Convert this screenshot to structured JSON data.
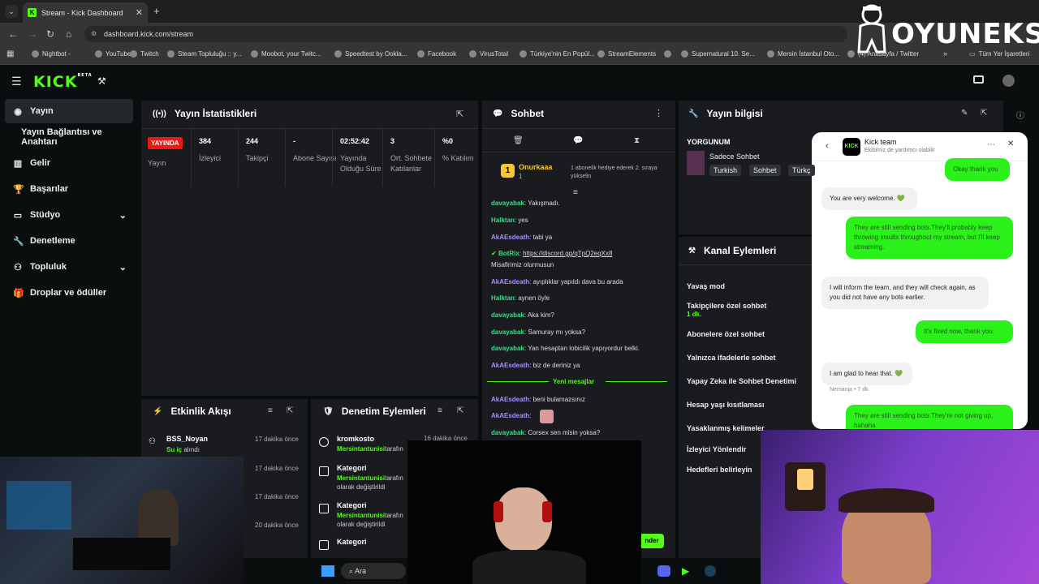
{
  "browser": {
    "tab_title": "Stream - Kick Dashboard",
    "url": "dashboard.kick.com/stream",
    "bookmarks": [
      "Nightbot -",
      "YouTube",
      "Twitch",
      "Steam Topluluğu :: y...",
      "Moobot, your Twitc...",
      "Speedtest by Ookla...",
      "Facebook",
      "VirusTotal",
      "Türkiye'nin En Popül...",
      "StreamElements",
      "",
      "Supernatural 10. Se...",
      "Mersin İstanbul Oto...",
      "(4) Anasayfa / Twitter"
    ],
    "bookmarks_all": "Tüm Yer İşaretleri"
  },
  "overlay_logo": "OYUNEKS",
  "app": {
    "logo": "KICK",
    "logo_badge": "BETA",
    "sidebar": [
      {
        "label": "Yayın",
        "icon": "broadcast-icon"
      },
      {
        "label": "Yayın Bağlantısı ve Anahtarı",
        "icon": ""
      },
      {
        "label": "Gelir",
        "icon": "chart-icon"
      },
      {
        "label": "Başarılar",
        "icon": "trophy-icon"
      },
      {
        "label": "Stüdyo",
        "icon": "monitor-icon"
      },
      {
        "label": "Denetleme",
        "icon": "wrench-icon"
      },
      {
        "label": "Topluluk",
        "icon": "users-icon"
      },
      {
        "label": "Droplar ve ödüller",
        "icon": "gift-icon"
      }
    ]
  },
  "stats": {
    "title": "Yayın İstatistikleri",
    "live_badge": "YAYINDA",
    "live_label": "Yayın",
    "cols": [
      {
        "value": "384",
        "label": "İzleyici"
      },
      {
        "value": "244",
        "label": "Takipçi"
      },
      {
        "value": "-",
        "label": "Abone Sayısı"
      },
      {
        "value": "02:52:42",
        "label": "Yayında Olduğu Süre"
      },
      {
        "value": "3",
        "label": "Ort. Sohbete Katılanlar"
      },
      {
        "value": "%0",
        "label": "% Katılım"
      }
    ]
  },
  "chat": {
    "title": "Sohbet",
    "pinned_user": "Onurkaaa",
    "pinned_count": "1",
    "pinned_text": "1 abonelik hediye ederek 2. sıraya yükselin",
    "messages": [
      {
        "user": "davayabak",
        "text": "Yakışmadı.",
        "color": "g"
      },
      {
        "user": "Halktan",
        "text": "yes",
        "color": "g"
      },
      {
        "user": "AkAEsdeath",
        "text": "tabi ya",
        "color": "p"
      },
      {
        "user": "BotRix",
        "text": "https://discord.gg/qTpQ2eqXx8",
        "color": "g"
      },
      {
        "user": "",
        "text": "Misafirimiz olurmusun",
        "color": ""
      },
      {
        "user": "AkAEsdeath",
        "text": "ayıplıklar yapıldı dava bu arada",
        "color": "p"
      },
      {
        "user": "Halktan",
        "text": "aynen öyle",
        "color": "g"
      },
      {
        "user": "davayabak",
        "text": "Aka kim?",
        "color": "g"
      },
      {
        "user": "davayabak",
        "text": "Samuray mı yoksa?",
        "color": "g"
      },
      {
        "user": "davayabak",
        "text": "Yan hesaptan lobicilik yapıyordur belki.",
        "color": "g"
      },
      {
        "user": "AkAEsdeath",
        "text": "biz de deriniz ya",
        "color": "p"
      }
    ],
    "new_messages": "Yeni mesajlar",
    "after": [
      {
        "user": "AkAEsdeath",
        "text": "beni bulamazsınız",
        "color": "p"
      },
      {
        "user": "AkAEsdeath",
        "text": "",
        "color": "p"
      },
      {
        "user": "davayabak",
        "text": "Corsex sen misin yoksa?",
        "color": "g"
      }
    ],
    "send": "nder"
  },
  "stream_info": {
    "title": "Yayın bilgisi",
    "stream_title": "YORGUNUM",
    "category": "Sadece Sohbet",
    "tags": [
      "Turkish",
      "Sohbet",
      "Türkç"
    ]
  },
  "channel_actions": {
    "title": "Kanal Eylemleri",
    "items": [
      {
        "label": "Yavaş mod",
        "sub": ""
      },
      {
        "label": "Takipçilere özel sohbet",
        "sub": "1 dk."
      },
      {
        "label": "Abonelere özel sohbet",
        "sub": ""
      },
      {
        "label": "Yalnızca ifadelerle sohbet",
        "sub": ""
      },
      {
        "label": "Yapay Zeka ile Sohbet Denetimi",
        "sub": ""
      },
      {
        "label": "Hesap yaşı kısıtlaması",
        "sub": ""
      },
      {
        "label": "Yasaklanmış kelimeler",
        "sub": ""
      },
      {
        "label": "İzleyici Yönlendir",
        "sub": ""
      },
      {
        "label": "Hedefleri belirleyin",
        "sub": ""
      }
    ]
  },
  "activity": {
    "title": "Etkinlik Akışı",
    "items": [
      {
        "name": "BSS_Noyan",
        "sub": "Su iç",
        "suffix": "alındı",
        "time": "17 dakika önce"
      },
      {
        "name": "",
        "sub": "",
        "suffix": "",
        "time": "17 dakika önce"
      },
      {
        "name": "",
        "sub": "",
        "suffix": "",
        "time": "17 dakika önce"
      },
      {
        "name": "",
        "sub": "",
        "suffix": "",
        "time": "20 dakika önce"
      }
    ]
  },
  "moderation": {
    "title": "Denetim Eylemleri",
    "items": [
      {
        "name": "kromkosto",
        "by": "Mersintantunisi",
        "rest": "tarafın",
        "time": "16 dakika önce"
      },
      {
        "name": "Kategori",
        "by": "Mersintantunisi",
        "rest": "tarafın",
        "line2": "olarak değiştirildi"
      },
      {
        "name": "Kategori",
        "by": "Mersintantunisi",
        "rest": "tarafın",
        "line2": "olarak değiştirildi"
      },
      {
        "name": "Kategori",
        "by": "",
        "rest": "",
        "line2": ""
      }
    ]
  },
  "support": {
    "name": "Kick team",
    "sub": "Ekibimiz de yardımcı olabilir",
    "messages": [
      {
        "from": "me",
        "text": "Okay thank you"
      },
      {
        "from": "bot",
        "text": "You are very welcome. 💚"
      },
      {
        "from": "me",
        "text": "They are still sending bots.They'll probably keep throwing insults throughout my stream, but I'll keep streaming."
      },
      {
        "from": "bot",
        "text": "I will inform the team, and they will check again, as you did not have any bots earlier."
      },
      {
        "from": "me",
        "text": "It's fixed now, thank you."
      },
      {
        "from": "bot",
        "text": "I am glad to hear that. 💚"
      },
      {
        "from": "meta",
        "text": "Nemanja • 7 dk"
      },
      {
        "from": "me",
        "text": "They are still sending bots They're not giving up, hahaha"
      }
    ]
  },
  "taskbar": {
    "search": "Ara"
  },
  "colors": {
    "kick_green": "#53fc18",
    "panel": "#191b1f",
    "bg": "#0b0e0f",
    "live_red": "#e91916"
  }
}
